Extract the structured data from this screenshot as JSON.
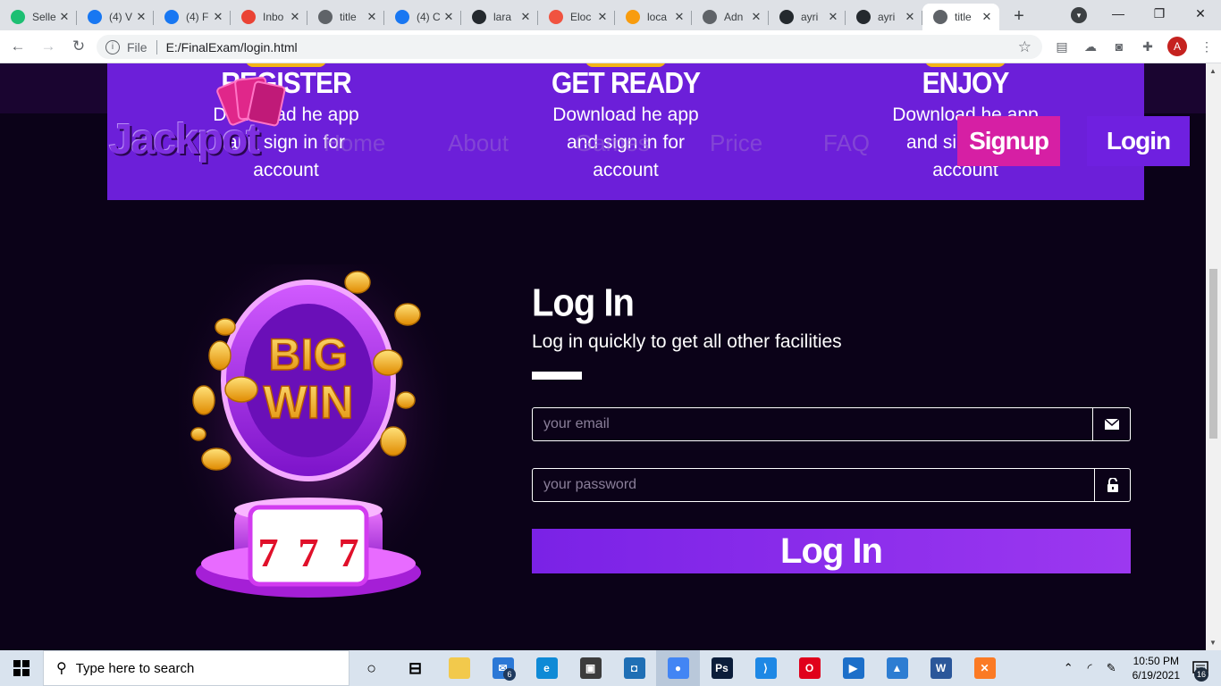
{
  "browser": {
    "tabs": [
      {
        "title": "Selle",
        "icon": "fiverr-icon",
        "color": "#1dbf73"
      },
      {
        "title": "(4) V",
        "icon": "facebook-icon",
        "color": "#1877f2"
      },
      {
        "title": "(4) F",
        "icon": "facebook-icon",
        "color": "#1877f2"
      },
      {
        "title": "Inbo",
        "icon": "gmail-icon",
        "color": "#ea4335"
      },
      {
        "title": "title",
        "icon": "globe-icon",
        "color": "#5f6368"
      },
      {
        "title": "(4) C",
        "icon": "facebook-icon",
        "color": "#1877f2"
      },
      {
        "title": "lara",
        "icon": "github-icon",
        "color": "#24292e"
      },
      {
        "title": "Eloc",
        "icon": "laravel-icon",
        "color": "#f05340"
      },
      {
        "title": "loca",
        "icon": "phpmyadmin-icon",
        "color": "#f89c0e"
      },
      {
        "title": "Adn",
        "icon": "globe-icon",
        "color": "#5f6368"
      },
      {
        "title": "ayri",
        "icon": "github-icon",
        "color": "#24292e"
      },
      {
        "title": "ayri",
        "icon": "github-icon",
        "color": "#24292e"
      },
      {
        "title": "title",
        "icon": "globe-icon",
        "color": "#5f6368",
        "active": true
      }
    ],
    "address": {
      "scheme": "File",
      "url": "E:/FinalExam/login.html"
    },
    "profile_initial": "A"
  },
  "site": {
    "steps": [
      {
        "title": "REGISTER",
        "text": "Download he app and sign in for account"
      },
      {
        "title": "GET READY",
        "text": "Download he app and sign in for account"
      },
      {
        "title": "ENJOY",
        "text": "Download he app and sign in for account"
      }
    ],
    "logo": "Jackpot",
    "nav": [
      "Home",
      "About",
      "Games",
      "Price",
      "FAQ"
    ],
    "signup_label": "Signup",
    "login_label": "Login",
    "hero": {
      "line1": "BIG",
      "line2": "WIN",
      "reels": [
        "7",
        "7",
        "7"
      ]
    }
  },
  "login_form": {
    "title": "Log In",
    "subtitle": "Log in quickly to get all other facilities",
    "email_placeholder": "your email",
    "password_placeholder": "your password",
    "submit_label": "Log In"
  },
  "taskbar": {
    "search_placeholder": "Type here to search",
    "apps": [
      {
        "name": "cortana-icon",
        "glyph": "○"
      },
      {
        "name": "task-view-icon",
        "glyph": "⊟"
      },
      {
        "name": "file-explorer-icon",
        "glyph": "",
        "color": "#f2c94c"
      },
      {
        "name": "mail-icon",
        "glyph": "✉",
        "color": "#2b78d6",
        "badge": "6"
      },
      {
        "name": "edge-icon",
        "glyph": "e",
        "color": "#0f8ad6"
      },
      {
        "name": "store-icon",
        "glyph": "▣",
        "color": "#3c3c3c"
      },
      {
        "name": "app-icon",
        "glyph": "◘",
        "color": "#1f6fb5"
      },
      {
        "name": "chrome-icon",
        "glyph": "●",
        "color": "#4285f4",
        "active": true
      },
      {
        "name": "photoshop-icon",
        "glyph": "Ps",
        "color": "#0b1d3a"
      },
      {
        "name": "vscode-icon",
        "glyph": "⟩",
        "color": "#1e88e5"
      },
      {
        "name": "opera-icon",
        "glyph": "O",
        "color": "#e0001b"
      },
      {
        "name": "movies-icon",
        "glyph": "▶",
        "color": "#1c6fc9"
      },
      {
        "name": "photos-icon",
        "glyph": "▲",
        "color": "#2d7dd2"
      },
      {
        "name": "word-icon",
        "glyph": "W",
        "color": "#2b579a"
      },
      {
        "name": "xampp-icon",
        "glyph": "✕",
        "color": "#fb7a24"
      }
    ],
    "time": "10:50 PM",
    "date": "6/19/2021",
    "notification_count": "16"
  }
}
